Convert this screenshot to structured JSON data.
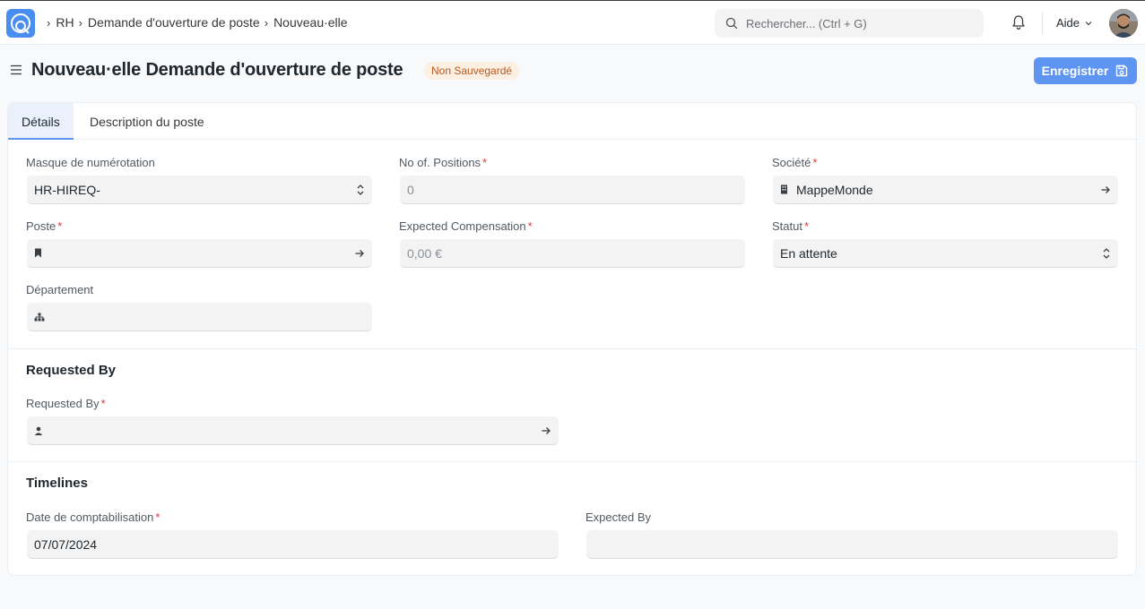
{
  "navbar": {
    "breadcrumb": [
      "RH",
      "Demande d'ouverture de poste",
      "Nouveau·elle"
    ],
    "search_placeholder": "Rechercher... (Ctrl + G)",
    "help_label": "Aide"
  },
  "page": {
    "title": "Nouveau·elle Demande d'ouverture de poste",
    "status": "Non Sauvegardé",
    "save_label": "Enregistrer"
  },
  "tabs": [
    {
      "label": "Détails",
      "active": true
    },
    {
      "label": "Description du poste",
      "active": false
    }
  ],
  "fields": {
    "naming_series": {
      "label": "Masque de numérotation",
      "value": "HR-HIREQ-"
    },
    "no_of_positions": {
      "label": "No of. Positions",
      "value": "0"
    },
    "company": {
      "label": "Société",
      "value": "MappeMonde"
    },
    "designation": {
      "label": "Poste",
      "value": ""
    },
    "expected_compensation": {
      "label": "Expected Compensation",
      "value": "0,00 €"
    },
    "status": {
      "label": "Statut",
      "value": "En attente"
    },
    "department": {
      "label": "Département",
      "value": ""
    },
    "requested_by": {
      "label": "Requested By",
      "value": ""
    },
    "posting_date": {
      "label": "Date de comptabilisation",
      "value": "07/07/2024"
    },
    "expected_by": {
      "label": "Expected By",
      "value": ""
    }
  },
  "sections": {
    "requested_by": "Requested By",
    "timelines": "Timelines"
  },
  "required_marker": "*",
  "colors": {
    "accent": "#5e94f2",
    "badge_bg": "#fdefe1",
    "badge_text": "#b95a1f",
    "required": "#e03636"
  }
}
